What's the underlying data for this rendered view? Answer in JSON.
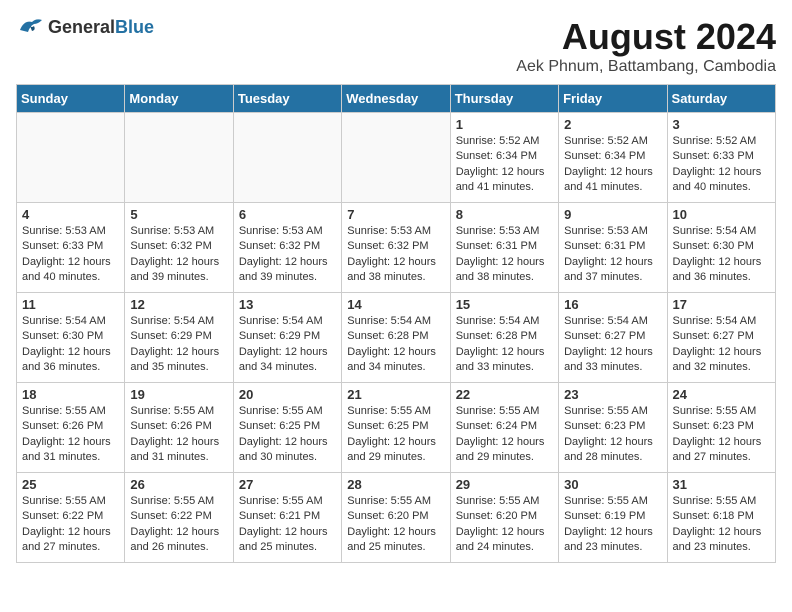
{
  "header": {
    "logo_general": "General",
    "logo_blue": "Blue",
    "title": "August 2024",
    "subtitle": "Aek Phnum, Battambang, Cambodia"
  },
  "calendar": {
    "days_of_week": [
      "Sunday",
      "Monday",
      "Tuesday",
      "Wednesday",
      "Thursday",
      "Friday",
      "Saturday"
    ],
    "weeks": [
      [
        {
          "day": "",
          "info": ""
        },
        {
          "day": "",
          "info": ""
        },
        {
          "day": "",
          "info": ""
        },
        {
          "day": "",
          "info": ""
        },
        {
          "day": "1",
          "info": "Sunrise: 5:52 AM\nSunset: 6:34 PM\nDaylight: 12 hours\nand 41 minutes."
        },
        {
          "day": "2",
          "info": "Sunrise: 5:52 AM\nSunset: 6:34 PM\nDaylight: 12 hours\nand 41 minutes."
        },
        {
          "day": "3",
          "info": "Sunrise: 5:52 AM\nSunset: 6:33 PM\nDaylight: 12 hours\nand 40 minutes."
        }
      ],
      [
        {
          "day": "4",
          "info": "Sunrise: 5:53 AM\nSunset: 6:33 PM\nDaylight: 12 hours\nand 40 minutes."
        },
        {
          "day": "5",
          "info": "Sunrise: 5:53 AM\nSunset: 6:32 PM\nDaylight: 12 hours\nand 39 minutes."
        },
        {
          "day": "6",
          "info": "Sunrise: 5:53 AM\nSunset: 6:32 PM\nDaylight: 12 hours\nand 39 minutes."
        },
        {
          "day": "7",
          "info": "Sunrise: 5:53 AM\nSunset: 6:32 PM\nDaylight: 12 hours\nand 38 minutes."
        },
        {
          "day": "8",
          "info": "Sunrise: 5:53 AM\nSunset: 6:31 PM\nDaylight: 12 hours\nand 38 minutes."
        },
        {
          "day": "9",
          "info": "Sunrise: 5:53 AM\nSunset: 6:31 PM\nDaylight: 12 hours\nand 37 minutes."
        },
        {
          "day": "10",
          "info": "Sunrise: 5:54 AM\nSunset: 6:30 PM\nDaylight: 12 hours\nand 36 minutes."
        }
      ],
      [
        {
          "day": "11",
          "info": "Sunrise: 5:54 AM\nSunset: 6:30 PM\nDaylight: 12 hours\nand 36 minutes."
        },
        {
          "day": "12",
          "info": "Sunrise: 5:54 AM\nSunset: 6:29 PM\nDaylight: 12 hours\nand 35 minutes."
        },
        {
          "day": "13",
          "info": "Sunrise: 5:54 AM\nSunset: 6:29 PM\nDaylight: 12 hours\nand 34 minutes."
        },
        {
          "day": "14",
          "info": "Sunrise: 5:54 AM\nSunset: 6:28 PM\nDaylight: 12 hours\nand 34 minutes."
        },
        {
          "day": "15",
          "info": "Sunrise: 5:54 AM\nSunset: 6:28 PM\nDaylight: 12 hours\nand 33 minutes."
        },
        {
          "day": "16",
          "info": "Sunrise: 5:54 AM\nSunset: 6:27 PM\nDaylight: 12 hours\nand 33 minutes."
        },
        {
          "day": "17",
          "info": "Sunrise: 5:54 AM\nSunset: 6:27 PM\nDaylight: 12 hours\nand 32 minutes."
        }
      ],
      [
        {
          "day": "18",
          "info": "Sunrise: 5:55 AM\nSunset: 6:26 PM\nDaylight: 12 hours\nand 31 minutes."
        },
        {
          "day": "19",
          "info": "Sunrise: 5:55 AM\nSunset: 6:26 PM\nDaylight: 12 hours\nand 31 minutes."
        },
        {
          "day": "20",
          "info": "Sunrise: 5:55 AM\nSunset: 6:25 PM\nDaylight: 12 hours\nand 30 minutes."
        },
        {
          "day": "21",
          "info": "Sunrise: 5:55 AM\nSunset: 6:25 PM\nDaylight: 12 hours\nand 29 minutes."
        },
        {
          "day": "22",
          "info": "Sunrise: 5:55 AM\nSunset: 6:24 PM\nDaylight: 12 hours\nand 29 minutes."
        },
        {
          "day": "23",
          "info": "Sunrise: 5:55 AM\nSunset: 6:23 PM\nDaylight: 12 hours\nand 28 minutes."
        },
        {
          "day": "24",
          "info": "Sunrise: 5:55 AM\nSunset: 6:23 PM\nDaylight: 12 hours\nand 27 minutes."
        }
      ],
      [
        {
          "day": "25",
          "info": "Sunrise: 5:55 AM\nSunset: 6:22 PM\nDaylight: 12 hours\nand 27 minutes."
        },
        {
          "day": "26",
          "info": "Sunrise: 5:55 AM\nSunset: 6:22 PM\nDaylight: 12 hours\nand 26 minutes."
        },
        {
          "day": "27",
          "info": "Sunrise: 5:55 AM\nSunset: 6:21 PM\nDaylight: 12 hours\nand 25 minutes."
        },
        {
          "day": "28",
          "info": "Sunrise: 5:55 AM\nSunset: 6:20 PM\nDaylight: 12 hours\nand 25 minutes."
        },
        {
          "day": "29",
          "info": "Sunrise: 5:55 AM\nSunset: 6:20 PM\nDaylight: 12 hours\nand 24 minutes."
        },
        {
          "day": "30",
          "info": "Sunrise: 5:55 AM\nSunset: 6:19 PM\nDaylight: 12 hours\nand 23 minutes."
        },
        {
          "day": "31",
          "info": "Sunrise: 5:55 AM\nSunset: 6:18 PM\nDaylight: 12 hours\nand 23 minutes."
        }
      ]
    ]
  }
}
